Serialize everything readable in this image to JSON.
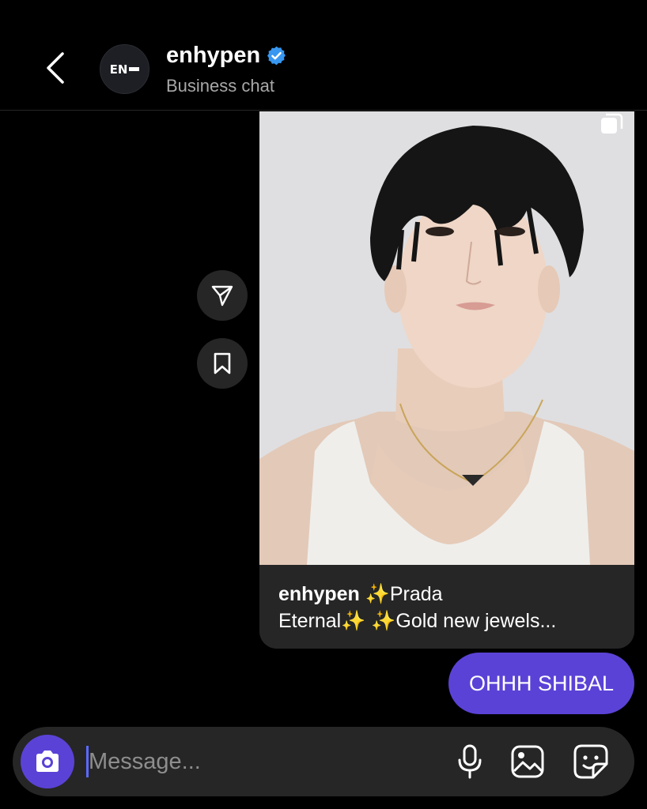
{
  "header": {
    "title": "enhypen",
    "subtitle": "Business chat",
    "avatar_text": "EN"
  },
  "shared_post": {
    "username": "enhypen",
    "caption_line1_suffix": " ✨Prada",
    "caption_line2": "Eternal✨ ✨Gold new jewels..."
  },
  "message": {
    "text": "OHHH SHIBAL"
  },
  "composer": {
    "placeholder": "Message..."
  },
  "colors": {
    "accent": "#5b42d6",
    "background": "#000000",
    "surface": "#262626",
    "verified": "#3897f0"
  },
  "icons": {
    "back": "chevron-left-icon",
    "verified": "verified-badge-icon",
    "share": "send-icon",
    "save": "bookmark-icon",
    "multi": "carousel-icon",
    "camera": "camera-icon",
    "mic": "microphone-icon",
    "gallery": "image-icon",
    "sticker": "sticker-icon"
  }
}
